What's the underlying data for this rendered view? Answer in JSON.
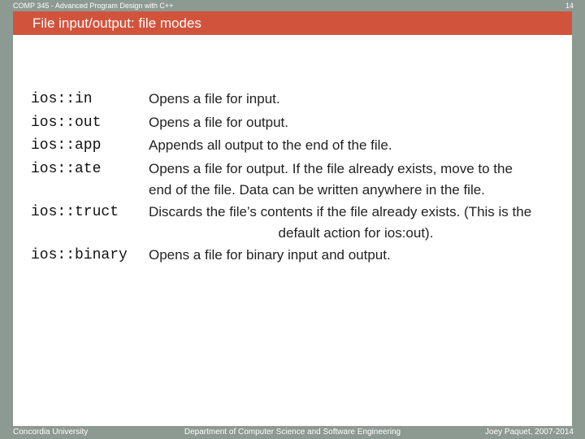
{
  "header": {
    "course": "COMP 345 - Advanced Program Design with C++",
    "page_number": "14"
  },
  "slide": {
    "title": "File input/output: file modes",
    "modes": [
      {
        "term": "ios::in",
        "lines": [
          "Opens a file for input."
        ]
      },
      {
        "term": "ios::out",
        "lines": [
          "Opens a file for output."
        ]
      },
      {
        "term": "ios::app",
        "lines": [
          "Appends all output to the end of the file."
        ]
      },
      {
        "term": "ios::ate",
        "lines": [
          "Opens a file for output. If the file already exists, move to the",
          "end of the file. Data can be written anywhere in the file."
        ]
      },
      {
        "term": "ios::truct",
        "lines": [
          "Discards the file’s contents if the file already exists. (This is the",
          "default action for ios:out)."
        ]
      },
      {
        "term": "ios::binary",
        "lines": [
          "Opens a file for binary input and output."
        ]
      }
    ]
  },
  "footer": {
    "left": "Concordia University",
    "center": "Department of Computer Science and Software Engineering",
    "right": "Joey Paquet, 2007-2014"
  }
}
